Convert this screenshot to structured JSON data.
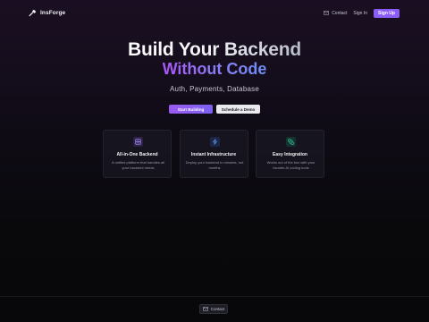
{
  "nav": {
    "brand": "InsForge",
    "contact_label": "Contact",
    "signin_label": "Sign In",
    "signup_label": "Sign Up"
  },
  "hero": {
    "title_line1": "Build Your Backend",
    "title_line2": "Without Code",
    "subtitle": "Auth, Payments, Database",
    "primary_cta": "Start Building",
    "secondary_cta": "Schedule a Demo"
  },
  "features": [
    {
      "icon": "database-icon",
      "title": "All-in-One Backend",
      "description": "A unified platform that handles all your backend needs"
    },
    {
      "icon": "lightning-icon",
      "title": "Instant Infrastructure",
      "description": "Deploy your backend in minutes, not months"
    },
    {
      "icon": "integration-icon",
      "title": "Easy Integration",
      "description": "Works out of the box with your favorite AI coding tools"
    }
  ],
  "footer": {
    "contact_label": "Contact"
  },
  "colors": {
    "accent": "#8b5cf6",
    "gradient_start": "#a855f7",
    "gradient_end": "#6f8ef5",
    "feature_icon_1": "#a78bfa",
    "feature_icon_2": "#60a5fa",
    "feature_icon_3": "#34d399"
  }
}
